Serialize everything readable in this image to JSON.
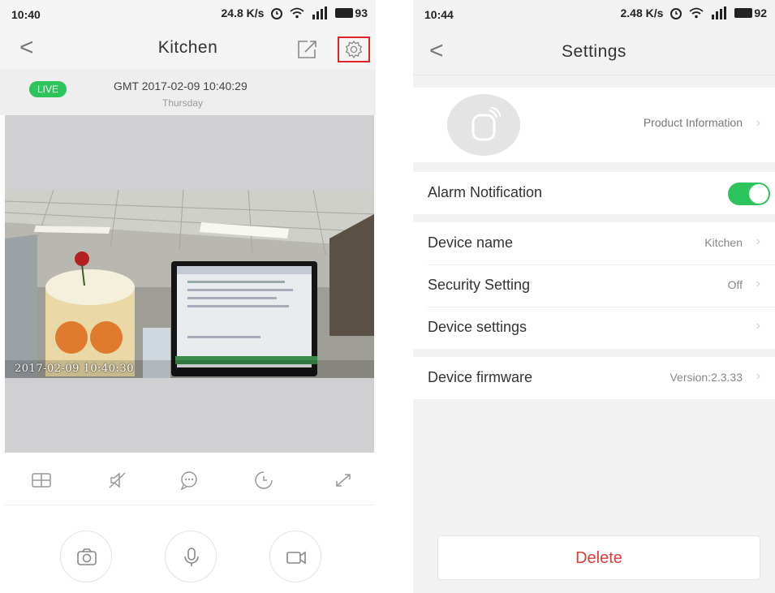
{
  "left_screen": {
    "status_bar": {
      "time": "10:40",
      "speed": "24.8 K/s",
      "battery": "93"
    },
    "nav": {
      "back": "<",
      "title": "Kitchen"
    },
    "live": {
      "badge": "LIVE",
      "datetime": "GMT 2017-02-09 10:40:29",
      "weekday": "Thursday"
    },
    "video": {
      "osd_timestamp": "2017-02-09 10:40:30"
    },
    "controls": [
      "layout-icon",
      "mute-icon",
      "message-icon",
      "history-icon",
      "fullscreen-icon"
    ],
    "actions": [
      "camera-icon",
      "microphone-icon",
      "record-icon"
    ],
    "accent_color": "#2ec45c",
    "highlight_color": "#e0242a"
  },
  "right_screen": {
    "status_bar": {
      "time": "10:44",
      "speed": "2.48 K/s",
      "battery": "92"
    },
    "nav": {
      "back": "<",
      "title": "Settings"
    },
    "product": {
      "label": "Product Information"
    },
    "alarm": {
      "label": "Alarm Notification",
      "enabled": true
    },
    "device_rows": [
      {
        "label": "Device name",
        "value": "Kitchen"
      },
      {
        "label": "Security Setting",
        "value": "Off"
      },
      {
        "label": "Device settings",
        "value": ""
      }
    ],
    "firmware": {
      "label": "Device firmware",
      "value": "Version:2.3.33"
    },
    "delete_label": "Delete",
    "delete_color": "#e23a3a"
  }
}
